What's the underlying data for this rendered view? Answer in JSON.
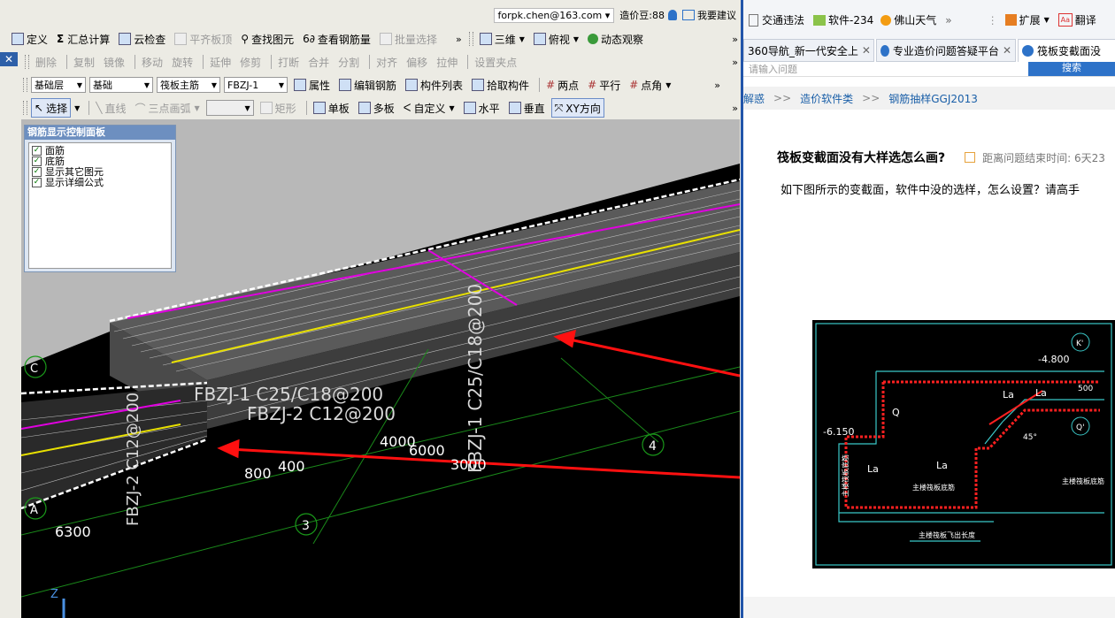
{
  "left_app": {
    "top_bar": {
      "account": "forpk.chen@163.com",
      "coins_label": "造价豆:88",
      "suggest": "我要建议"
    },
    "toolbar1": {
      "items": [
        {
          "label": "定义",
          "disabled": false
        },
        {
          "label": "汇总计算",
          "disabled": false
        },
        {
          "label": "云检查",
          "disabled": false
        },
        {
          "label": "平齐板顶",
          "disabled": true
        },
        {
          "label": "查找图元",
          "disabled": false
        },
        {
          "label": "查看钢筋量",
          "disabled": false
        },
        {
          "label": "批量选择",
          "disabled": true
        }
      ],
      "view_items": [
        "三维",
        "俯视",
        "动态观察"
      ]
    },
    "toolbar2": {
      "items": [
        "删除",
        "复制",
        "镜像",
        "移动",
        "旋转",
        "延伸",
        "修剪",
        "打断",
        "合并",
        "分割",
        "对齐",
        "偏移",
        "拉伸",
        "设置夹点"
      ]
    },
    "toolbar3": {
      "floor": "基础层",
      "category": "基础",
      "component_type": "筏板主筋",
      "component": "FBZJ-1",
      "items": [
        "属性",
        "编辑钢筋",
        "构件列表",
        "拾取构件",
        "两点",
        "平行",
        "点角"
      ]
    },
    "toolbar4": {
      "select": "选择",
      "items_disabled": [
        "直线",
        "三点画弧",
        "矩形"
      ],
      "items": [
        "单板",
        "多板",
        "自定义",
        "水平",
        "垂直",
        "XY方向"
      ]
    },
    "control_panel": {
      "title": "钢筋显示控制面板",
      "options": [
        "面筋",
        "底筋",
        "显示其它图元",
        "显示详细公式"
      ]
    },
    "viewport_labels": {
      "rebar1": "FBZJ-1 C25/C18@200",
      "rebar2": "FBZJ-2 C12@200",
      "vertical_rebar": "FBZJ-1 C25/C18@200",
      "left_vertical": "FBZJ-2 C12@200",
      "dim_4000": "4000",
      "dim_6000": "6000",
      "dim_3000": "3000",
      "dim_400": "400",
      "dim_800": "800",
      "dim_6300": "6300",
      "axis_3": "3",
      "axis_4": "4",
      "axis_a": "A",
      "axis_c": "C",
      "z_axis": "Z"
    }
  },
  "browser": {
    "bookmarks": [
      "交通违法",
      "软件-234",
      "佛山天气"
    ],
    "ext": "扩展",
    "translate": "翻译",
    "tabs": [
      {
        "label": "360导航_新一代安全上"
      },
      {
        "label": "专业造价问题答疑平台"
      },
      {
        "label": "筏板变截面没"
      }
    ],
    "search_partial": "请输入问题",
    "search_btn": "搜索",
    "breadcrumb": [
      "解惑",
      "造价软件类",
      "钢筋抽样GGJ2013"
    ],
    "question_title": "筏板变截面没有大样选怎么画?",
    "deadline": "距离问题结束时间: 6天23",
    "question_body": "如下图所示的变截面，软件中没的选样，怎么设置？请高手",
    "drawing": {
      "elev1": "-4.800",
      "elev2": "-6.150",
      "la": "La",
      "q": "Q",
      "dim500": "500",
      "angle": "45°",
      "label1": "主楼筏板底筋",
      "label2": "主楼筏板底筋",
      "label3": "主楼筏板底筋",
      "label4": "主楼筏板飞出长度",
      "axis_k": "K'",
      "axis_q": "Q'"
    }
  }
}
